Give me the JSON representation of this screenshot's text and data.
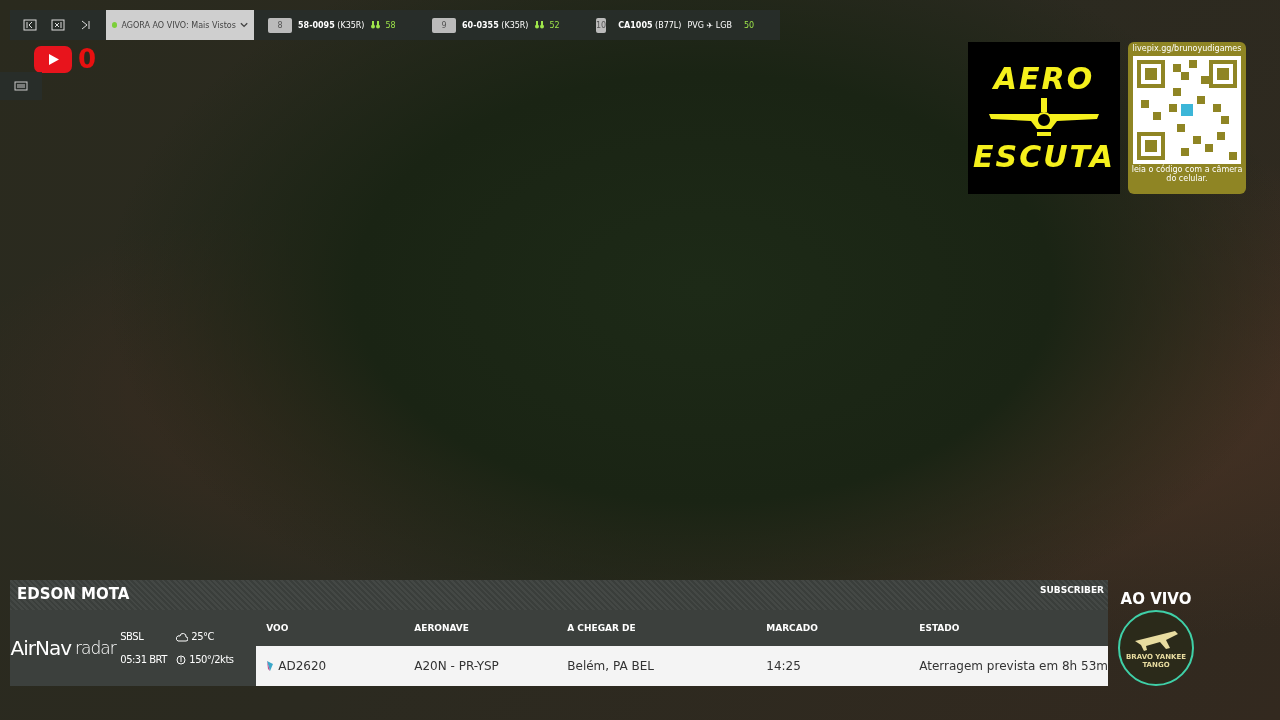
{
  "toolbar": {
    "dropdown": {
      "label": "AGORA AO VIVO:",
      "value": "Mais Vistos"
    },
    "flights": [
      {
        "rank": "8",
        "callsign": "58-0095",
        "type": "(K35R)",
        "watchers": "58",
        "airline_mark": false
      },
      {
        "rank": "9",
        "callsign": "60-0355",
        "type": "(K35R)",
        "watchers": "52",
        "airline_mark": false
      },
      {
        "rank": "10",
        "callsign": "CA1005",
        "type": "(B77L)",
        "route": {
          "from": "PVG",
          "arrow": "✈",
          "to": "LGB"
        },
        "watchers": "50",
        "airline_mark": true
      }
    ]
  },
  "youtube": {
    "count": "0"
  },
  "aero_logo": {
    "top": "AERO",
    "bottom": "ESCUTA"
  },
  "qr_card": {
    "url": "livepix.gg/brunoyudigames",
    "caption": "leia o código com a câmera do celular."
  },
  "panel": {
    "name": "EDSON MOTA",
    "tag": "SUBSCRIBER",
    "brand": {
      "main": "AirNav",
      "sub": "radar"
    },
    "airport": {
      "code": "SBSL",
      "time": "05:31 BRT",
      "temperature": "25°C",
      "wind": "150°/2kts"
    },
    "columns": [
      "VOO",
      "AERONAVE",
      "A CHEGAR DE",
      "MARCADO",
      "ESTADO"
    ],
    "row": [
      "AD2620",
      "A20N - PR-YSP",
      "Belém, PA BEL",
      "14:25",
      "Aterragem prevista em 8h 53m"
    ]
  },
  "live": {
    "label": "AO VIVO",
    "badge_text": "BRAVO YANKEE TANGO"
  }
}
